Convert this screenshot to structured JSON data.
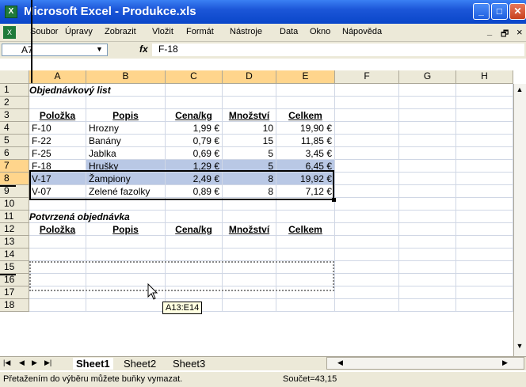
{
  "window": {
    "title": "Microsoft Excel - Produkce.xls",
    "app_icon": "excel-icon",
    "controls": [
      "minimize",
      "maximize",
      "close"
    ]
  },
  "menubar": {
    "items": [
      "Soubor",
      "Úpravy",
      "Zobrazit",
      "Vložit",
      "Formát",
      "Nástroje",
      "Data",
      "Okno",
      "Nápověda"
    ],
    "window_controls": [
      "_",
      "🗗",
      "×"
    ]
  },
  "formula_bar": {
    "name_box": "A7",
    "fx_label": "fx",
    "formula": "F-18"
  },
  "columns": [
    "A",
    "B",
    "C",
    "D",
    "E",
    "F",
    "G",
    "H"
  ],
  "rows": [
    "1",
    "2",
    "3",
    "4",
    "5",
    "6",
    "7",
    "8",
    "9",
    "10",
    "11",
    "12",
    "13",
    "14",
    "15",
    "16",
    "17",
    "18"
  ],
  "cells": {
    "A1": "Objednávkový list",
    "A3": "Položka",
    "B3": "Popis",
    "C3": "Cena/kg",
    "D3": "Množství",
    "E3": "Celkem",
    "A4": "F-10",
    "B4": "Hrozny",
    "C4": "1,99 €",
    "D4": "10",
    "E4": "19,90 €",
    "A5": "F-22",
    "B5": "Banány",
    "C5": "0,79 €",
    "D5": "15",
    "E5": "11,85 €",
    "A6": "F-25",
    "B6": "Jablka",
    "C6": "0,69 €",
    "D6": "5",
    "E6": "3,45 €",
    "A7": "F-18",
    "B7": "Hrušky",
    "C7": "1,29 €",
    "D7": "5",
    "E7": "6,45 €",
    "A8": "V-17",
    "B8": "Žampiony",
    "C8": "2,49 €",
    "D8": "8",
    "E8": "19,92 €",
    "A9": "V-07",
    "B9": "Zelené fazolky",
    "C9": "0,89 €",
    "D9": "8",
    "E9": "7,12 €",
    "A11": "Potvrzená objednávka",
    "A12": "Položka",
    "B12": "Popis",
    "C12": "Cena/kg",
    "D12": "Množství",
    "E12": "Celkem"
  },
  "drag_tooltip": "A13:E14",
  "sheet_tabs": [
    "Sheet1",
    "Sheet2",
    "Sheet3"
  ],
  "active_sheet": "Sheet1",
  "status_bar": {
    "message": "Přetažením do výběru můžete buňky vymazat.",
    "sum": "Součet=43,15"
  }
}
